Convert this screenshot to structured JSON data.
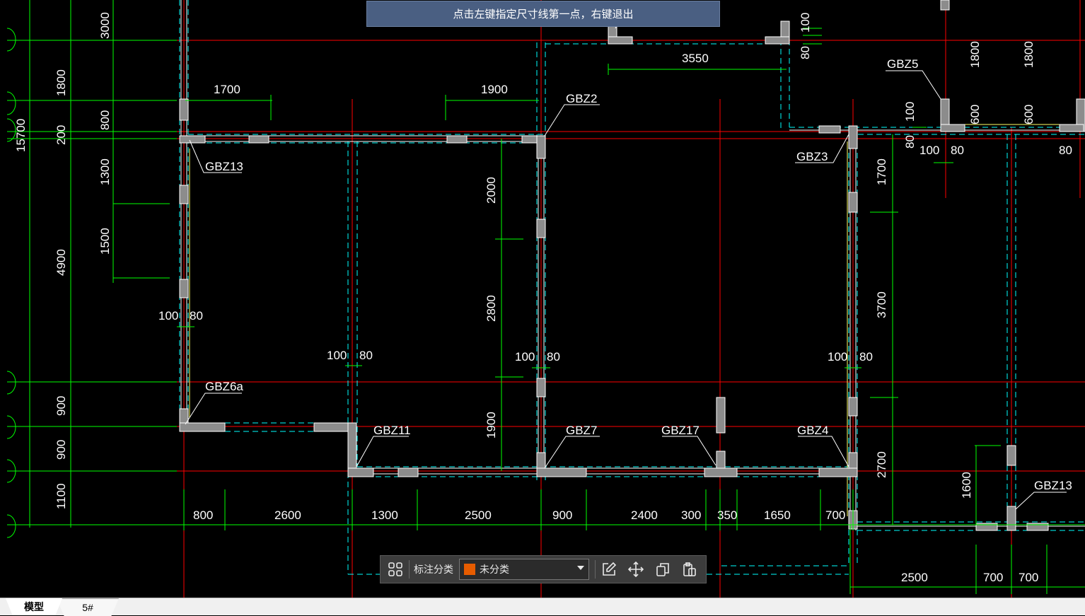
{
  "prompt": {
    "text": "点击左键指定尺寸线第一点，右键退出"
  },
  "toolbar": {
    "label": "标注分类",
    "selected": "未分类",
    "swatch_color": "#e65c00",
    "icons": [
      "grid-icon",
      "edit-icon",
      "move-icon",
      "copy-icon",
      "paste-icon"
    ]
  },
  "tabs": [
    {
      "label": "模型",
      "active": true
    },
    {
      "label": "5#",
      "active": false
    }
  ],
  "drawing": {
    "colors": {
      "axis": "#ff0000",
      "dim": "#00ff00",
      "dash": "#00ffff",
      "wall": "#ffffff",
      "column": "#8c8c8c",
      "accent": "#ffff66"
    },
    "left_dims": [
      "3000",
      "1800",
      "15700",
      "800",
      "200",
      "1300",
      "1500",
      "4900",
      "900",
      "900",
      "1100"
    ],
    "bottom_dims": [
      "800",
      "2600",
      "1300",
      "2500",
      "900",
      "2400",
      "300",
      "350",
      "1650",
      "700",
      "2500",
      "700",
      "700"
    ],
    "misc_dims": [
      "1700",
      "1900",
      "3550",
      "2000",
      "2800",
      "1900",
      "1700",
      "3700",
      "2700",
      "1800",
      "1800",
      "600",
      "600",
      "100",
      "80",
      "1600"
    ],
    "column_labels": [
      "GBZ2",
      "GBZ13",
      "GBZ3",
      "GBZ5",
      "GBZ6a",
      "GBZ11",
      "GBZ7",
      "GBZ17",
      "GBZ4",
      "GBZ13"
    ]
  }
}
